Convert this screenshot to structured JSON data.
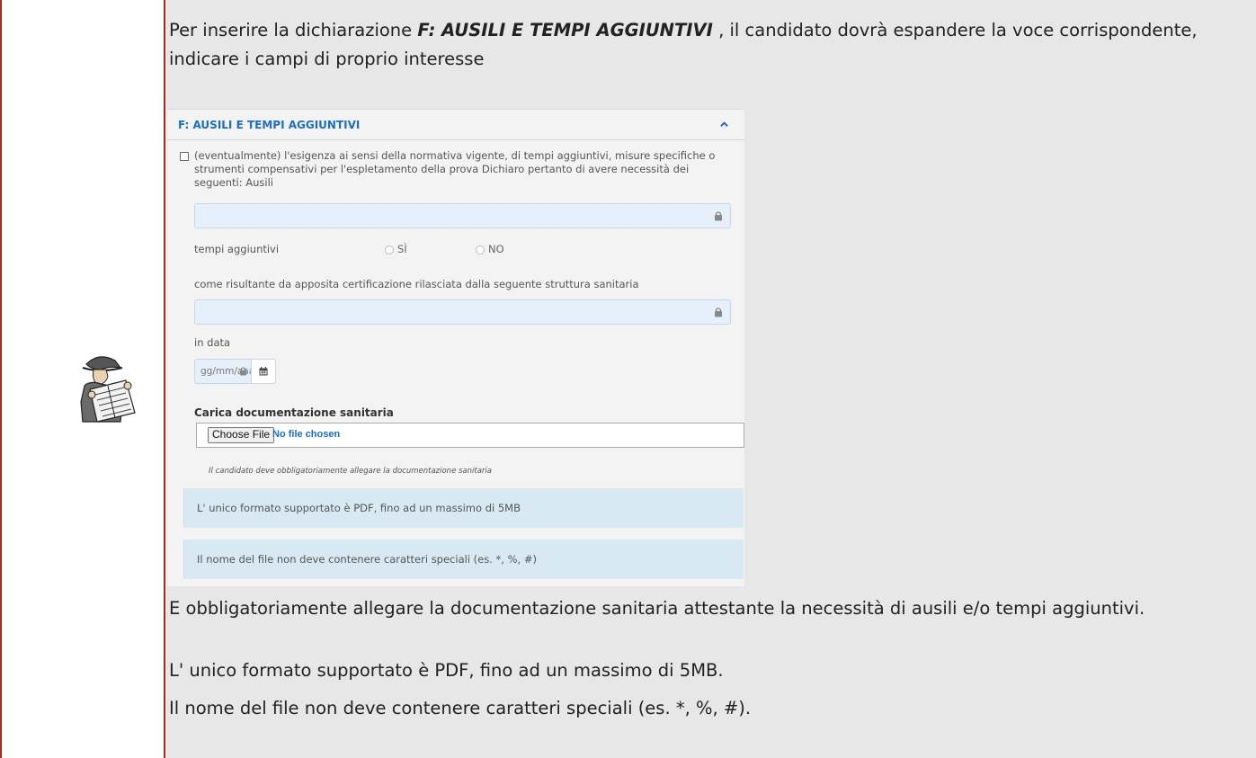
{
  "intro": {
    "before": "Per inserire la dichiarazione ",
    "highlight": "F: AUSILI E TEMPI AGGIUNTIVI",
    "after": " , il candidato dovrà espandere la voce corrispondente, indicare i campi di proprio interesse"
  },
  "form": {
    "title": "F: AUSILI E TEMPI AGGIUNTIVI",
    "checkbox_text": "(eventualmente) l'esigenza ai sensi della normativa vigente, di tempi aggiuntivi, misure specifiche o strumenti compensativi per l'espletamento della prova Dichiaro pertanto di avere necessità dei seguenti: Ausili",
    "tempi_label": "tempi aggiuntivi",
    "radio_yes": "SÌ",
    "radio_no": "NO",
    "certificazione_label": "come risultante da apposita certificazione rilasciata dalla seguente struttura sanitaria",
    "data_label": "in data",
    "date_placeholder": "gg/mm/aaaa",
    "upload_title": "Carica documentazione sanitaria",
    "file_button": "Choose File",
    "file_status": "No file chosen",
    "hint": "Il candidato deve obbligatoriamente allegare la documentazione sanitaria",
    "info1": "L' unico formato supportato è PDF, fino ad un massimo di 5MB",
    "info2": "Il nome del file non deve contenere caratteri speciali (es. *, %, #)"
  },
  "notes": {
    "line1": "E obbligatoriamente allegare la documentazione sanitaria attestante la necessità di ausili e/o tempi aggiuntivi.",
    "line2": "L' unico formato supportato è PDF, fino ad un massimo di 5MB.",
    "line3": "Il nome del file non deve contenere caratteri speciali (es. *, %, #)."
  },
  "colors": {
    "border": "#a52a2a",
    "panel_bg": "#e7e7e7",
    "link_blue": "#1a6fc4",
    "info_bg": "#d8e9f3"
  }
}
